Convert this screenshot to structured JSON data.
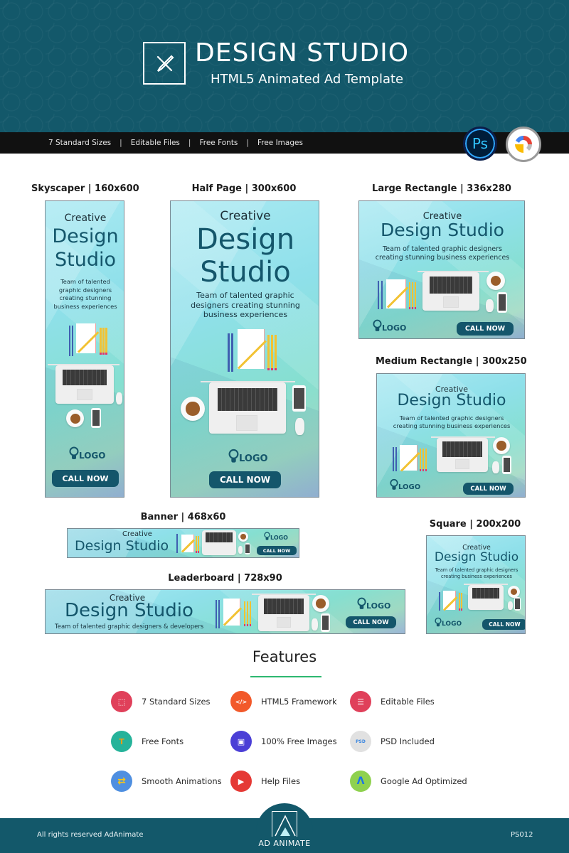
{
  "header": {
    "title": "DESIGN STUDIO",
    "subtitle": "HTML5 Animated Ad Template",
    "logo_icon": "pencil-brush-cross-icon"
  },
  "feature_bar": {
    "items": [
      "7 Standard Sizes",
      "Editable Files",
      "Free Fonts",
      "Free Images"
    ],
    "separator": "|",
    "badges": [
      {
        "name": "photoshop-badge",
        "label": "Ps"
      },
      {
        "name": "google-web-designer-badge",
        "label": ""
      }
    ]
  },
  "ads": {
    "creative": "Creative",
    "headline_1": "Design",
    "headline_2": "Studio",
    "headline": "Design Studio",
    "cta": "CALL NOW",
    "logo": "LOGO",
    "skyscraper": {
      "label": "Skyscaper | 160x600",
      "tagline": [
        "Team of talented",
        "graphic designers",
        "creating stunning",
        "business experiences"
      ]
    },
    "half_page": {
      "label": "Half Page | 300x600",
      "tagline": [
        "Team of talented graphic",
        "designers creating stunning",
        "business experiences"
      ]
    },
    "large_rectangle": {
      "label": "Large Rectangle | 336x280",
      "tagline": [
        "Team of talented graphic designers",
        "creating stunning business experiences"
      ]
    },
    "medium_rectangle": {
      "label": "Medium Rectangle | 300x250",
      "tagline": [
        "Team of talented graphic designers",
        "creating stunning business experiences"
      ]
    },
    "banner": {
      "label": "Banner | 468x60"
    },
    "leaderboard": {
      "label": "Leaderboard | 728x90",
      "tagline": "Team of talented graphic designers & developers"
    },
    "square": {
      "label": "Square | 200x200",
      "tagline": [
        "Team of talented graphic designers",
        "creating business experiences"
      ]
    }
  },
  "features": {
    "title": "Features",
    "accent_color": "#2db870",
    "items": [
      {
        "label": "7 Standard Sizes",
        "icon": "resize-frame-icon",
        "color": "#e0405a"
      },
      {
        "label": "HTML5 Framework",
        "icon": "html-file-icon",
        "color": "#f2592a"
      },
      {
        "label": "Editable Files",
        "icon": "checklist-pencil-icon",
        "color": "#e0405a"
      },
      {
        "label": "Free Fonts",
        "icon": "font-file-icon",
        "color": "#26b39a"
      },
      {
        "label": "100% Free Images",
        "icon": "images-icon",
        "color": "#4b3fd6"
      },
      {
        "label": "PSD Included",
        "icon": "psd-file-icon",
        "color": "#e1e1e1"
      },
      {
        "label": "Smooth Animations",
        "icon": "swap-arrows-icon",
        "color": "#4f8fe0"
      },
      {
        "label": "Help Files",
        "icon": "help-document-play-icon",
        "color": "#e53935"
      },
      {
        "label": "Google Ad Optimized",
        "icon": "google-ads-icon",
        "color": "#8fd14f"
      }
    ]
  },
  "footer": {
    "copyright": "All rights reserved AdAnimate",
    "brand": "AD ANIMATE",
    "code": "PS012"
  },
  "colors": {
    "brand_teal": "#13586a",
    "cta_teal": "#14566b",
    "bar_black": "#111111"
  }
}
